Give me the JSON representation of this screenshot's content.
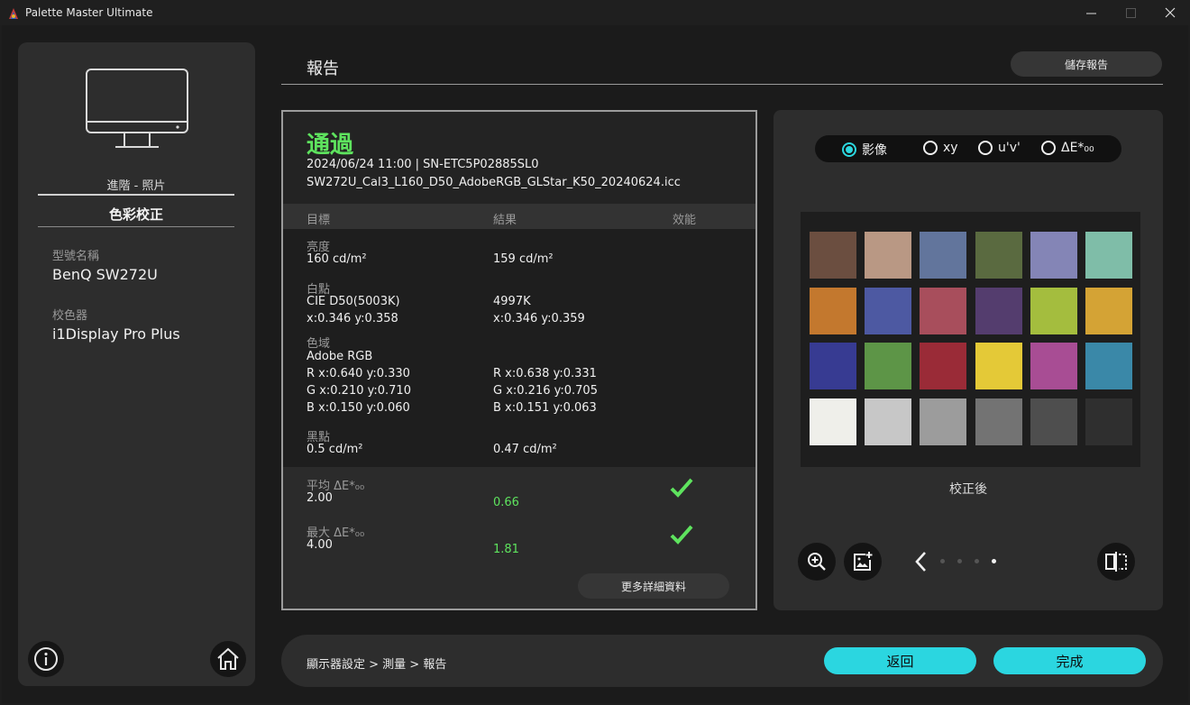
{
  "window": {
    "title": "Palette Master Ultimate",
    "controls": [
      "minimize",
      "maximize",
      "close"
    ]
  },
  "sidebar": {
    "mode": "進階 - 照片",
    "section": "色彩校正",
    "model_label": "型號名稱",
    "model_value": "BenQ SW272U",
    "calibrator_label": "校色器",
    "calibrator_value": "i1Display Pro Plus",
    "icons": [
      "monitor-icon",
      "info-icon",
      "home-icon"
    ]
  },
  "header": {
    "title": "報告",
    "save_button": "儲存報告"
  },
  "report": {
    "status": "通過",
    "status_color": "#5ee35e",
    "meta_line1": "2024/06/24 11:00 | SN-ETC5P02885SL0",
    "meta_line2": "SW272U_Cal3_L160_D50_AdobeRGB_GLStar_K50_20240624.icc",
    "columns": [
      "目標",
      "結果",
      "效能"
    ],
    "luminance": {
      "label": "亮度",
      "target": "160 cd/m²",
      "result": "159 cd/m²"
    },
    "white_point": {
      "label": "白點",
      "target1": "CIE D50(5003K)",
      "target2": "x:0.346 y:0.358",
      "result1": "4997K",
      "result2": "x:0.346 y:0.359"
    },
    "gamut": {
      "label": "色域",
      "target0": "Adobe RGB",
      "r_target": "R x:0.640 y:0.330",
      "r_result": "R x:0.638 y:0.331",
      "g_target": "G x:0.210 y:0.710",
      "g_result": "G x:0.216 y:0.705",
      "b_target": "B x:0.150 y:0.060",
      "b_result": "B x:0.151 y:0.063"
    },
    "black_point": {
      "label": "黑點",
      "target": "0.5 cd/m²",
      "result": "0.47 cd/m²"
    },
    "avg_de": {
      "label": "平均 ΔE*₀₀",
      "target": "2.00",
      "result": "0.66",
      "pass": true
    },
    "max_de": {
      "label": "最大 ΔE*₀₀",
      "target": "4.00",
      "result": "1.81",
      "pass": true
    },
    "more_button": "更多詳細資料"
  },
  "preview": {
    "options": [
      {
        "label": "影像",
        "selected": true
      },
      {
        "label": "xy",
        "selected": false
      },
      {
        "label": "u'v'",
        "selected": false
      },
      {
        "label": "ΔE*₀₀",
        "selected": false
      }
    ],
    "swatches": [
      "#6b4e40",
      "#b99884",
      "#62759c",
      "#5a6a40",
      "#8485b6",
      "#7fbda8",
      "#c3782e",
      "#4d59a2",
      "#a84e5c",
      "#543d6e",
      "#a4bd3e",
      "#d4a335",
      "#373b92",
      "#5d9547",
      "#9a2b37",
      "#e4c937",
      "#a84d94",
      "#3a88a8",
      "#efefea",
      "#c7c7c7",
      "#9c9c9c",
      "#737373",
      "#4e4e4e",
      "#2f2f2f"
    ],
    "caption": "校正後",
    "tools": [
      "zoom-in-icon",
      "add-image-icon",
      "chevron-left-icon",
      "compare-icon"
    ],
    "pager": {
      "count": 4,
      "active": 4
    }
  },
  "footer": {
    "breadcrumb": "顯示器設定 >  測量 >  報告",
    "back_button": "返回",
    "done_button": "完成",
    "accent": "#2bd6e0"
  }
}
